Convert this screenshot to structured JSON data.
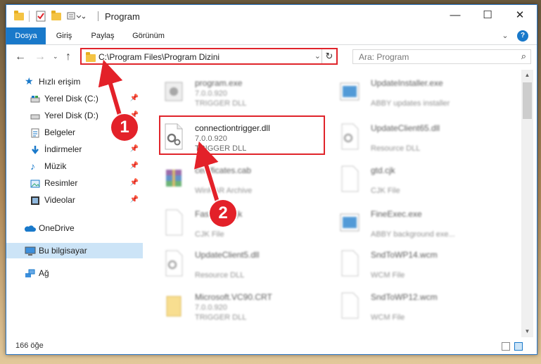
{
  "window": {
    "title": "Program",
    "controls": {
      "minimize": "—",
      "maximize": "☐",
      "close": "✕"
    }
  },
  "ribbon": {
    "tabs": [
      {
        "label": "Dosya",
        "active": true
      },
      {
        "label": "Giriş"
      },
      {
        "label": "Paylaş"
      },
      {
        "label": "Görünüm"
      }
    ],
    "expand": "⌄",
    "help": "?"
  },
  "address": {
    "path": "C:\\Program Files\\Program Dizini",
    "search_placeholder": "Ara: Program"
  },
  "nav": {
    "items": [
      {
        "label": "Hızlı erişim",
        "icon": "star-icon"
      },
      {
        "label": "Yerel Disk (C:)",
        "icon": "drive-icon",
        "pinned": true
      },
      {
        "label": "Yerel Disk (D:)",
        "icon": "drive-icon",
        "pinned": true
      },
      {
        "label": "Belgeler",
        "icon": "documents-icon",
        "pinned": true
      },
      {
        "label": "İndirmeler",
        "icon": "download-icon",
        "pinned": true
      },
      {
        "label": "Müzik",
        "icon": "music-icon",
        "pinned": true
      },
      {
        "label": "Resimler",
        "icon": "pictures-icon",
        "pinned": true
      },
      {
        "label": "Videolar",
        "icon": "videos-icon",
        "pinned": true
      },
      {
        "label": "OneDrive",
        "icon": "cloud-icon"
      },
      {
        "label": "Bu bilgisayar",
        "icon": "computer-icon",
        "selected": true
      },
      {
        "label": "Ağ",
        "icon": "network-icon"
      }
    ]
  },
  "files": {
    "left": [
      {
        "name": "program.exe",
        "version": "7.0.0.920",
        "type": "TRIGGER DLL"
      },
      {
        "name": "connectiontrigger.dll",
        "version": "7.0.0.920",
        "type": "TRIGGER DLL",
        "highlight": true
      },
      {
        "name": "certificates.cab",
        "version": "",
        "type": "WinRAR Archive"
      },
      {
        "name": "FastClick.cjk",
        "version": "",
        "type": "CJK File"
      },
      {
        "name": "UpdateClient5.dll",
        "version": "",
        "type": "Resource DLL"
      },
      {
        "name": "Microsoft.VC90.CRT",
        "version": "7.0.0.920",
        "type": "TRIGGER DLL"
      }
    ],
    "right": [
      {
        "name": "UpdateInstaller.exe",
        "version": "",
        "type": "ABBY updates installer"
      },
      {
        "name": "UpdateClient65.dll",
        "version": "",
        "type": "Resource DLL"
      },
      {
        "name": "gtd.cjk",
        "version": "",
        "type": "CJK File"
      },
      {
        "name": "FineExec.exe",
        "version": "",
        "type": "ABBY background exe..."
      },
      {
        "name": "SndToWP14.wcm",
        "version": "",
        "type": "WCM File"
      },
      {
        "name": "SndToWP12.wcm",
        "version": "",
        "type": "WCM File"
      }
    ]
  },
  "status": {
    "count": "166 öğe"
  },
  "callouts": [
    "1",
    "2"
  ],
  "colors": {
    "accent": "#1979ca",
    "highlight": "#e0242b",
    "selected": "#cce4f7"
  }
}
